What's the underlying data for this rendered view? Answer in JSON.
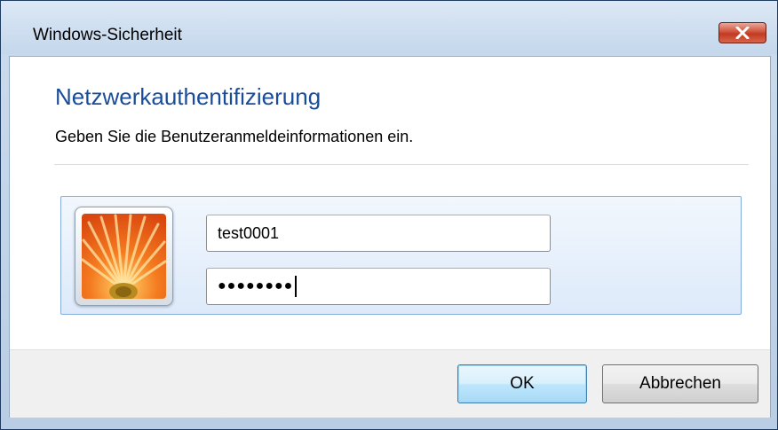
{
  "window": {
    "title": "Windows-Sicherheit"
  },
  "dialog": {
    "heading": "Netzwerkauthentifizierung",
    "instruction": "Geben Sie die Benutzeranmeldeinformationen ein."
  },
  "credentials": {
    "username_value": "test0001",
    "password_masked": "●●●●●●●●"
  },
  "buttons": {
    "ok_label": "OK",
    "cancel_label": "Abbrechen"
  },
  "icons": {
    "close": "close-icon",
    "avatar": "user-tile-flower-icon"
  },
  "colors": {
    "heading": "#1a4d99",
    "close_button": "#c23a22",
    "tile_border": "#84acdd",
    "ok_border": "#3c7fb1"
  }
}
